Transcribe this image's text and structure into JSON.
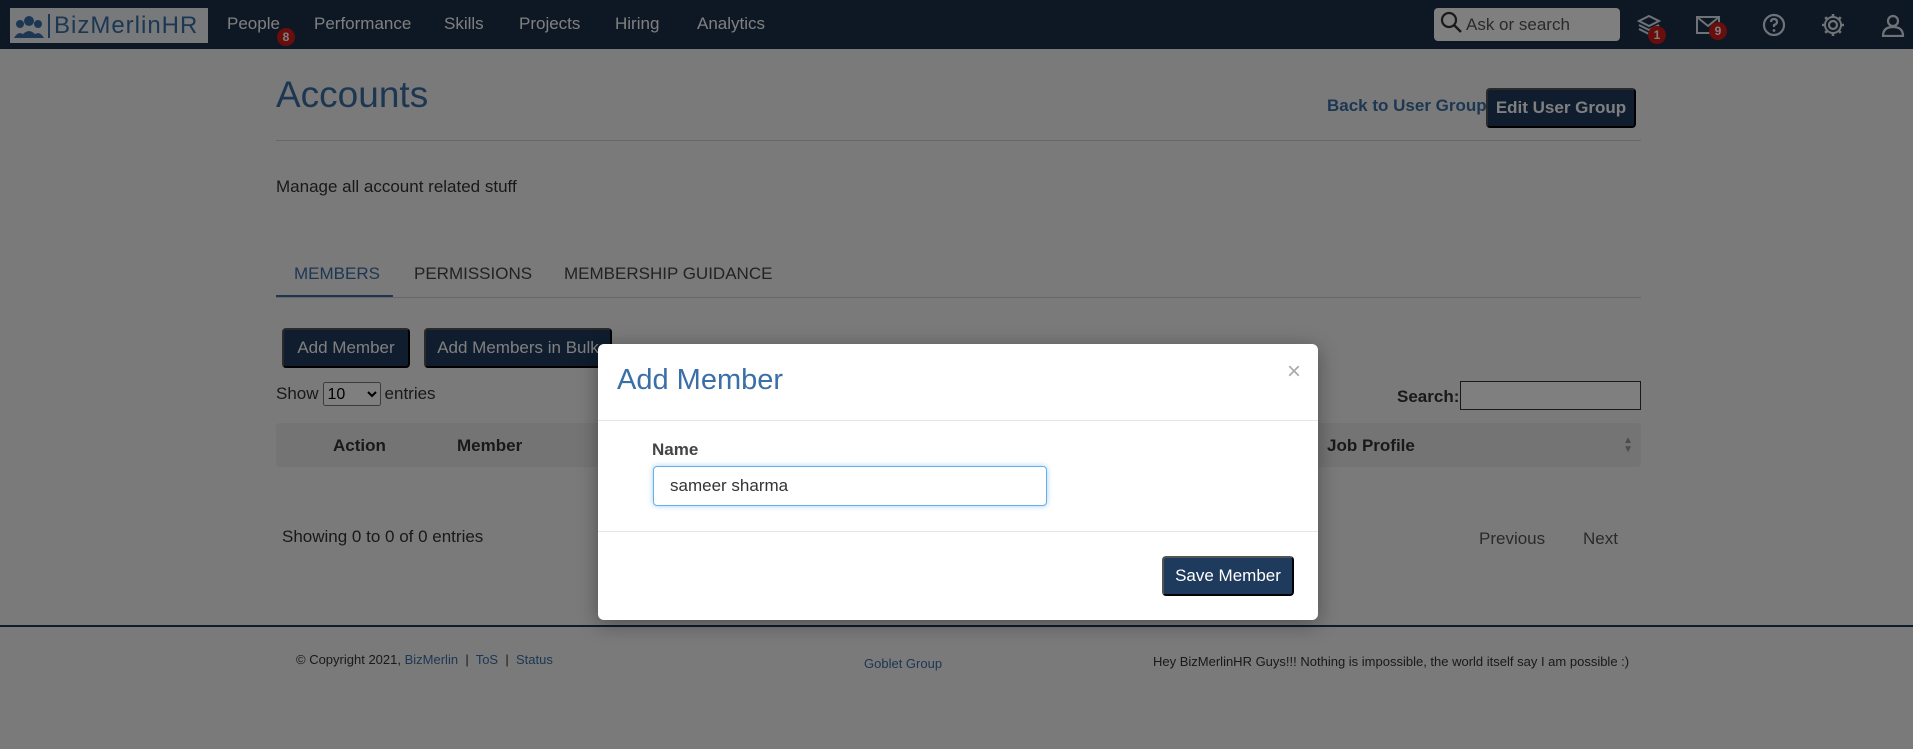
{
  "nav": {
    "logo_text": "BizMerlinHR",
    "items": [
      {
        "label": "People",
        "badge": "8"
      },
      {
        "label": "Performance"
      },
      {
        "label": "Skills"
      },
      {
        "label": "Projects"
      },
      {
        "label": "Hiring"
      },
      {
        "label": "Analytics"
      }
    ],
    "search_placeholder": "Ask or search",
    "icons": [
      {
        "name": "layers-icon",
        "badge": "1"
      },
      {
        "name": "mail-icon",
        "badge": "9"
      },
      {
        "name": "help-icon"
      },
      {
        "name": "gear-icon"
      },
      {
        "name": "user-icon"
      }
    ]
  },
  "page": {
    "title": "Accounts",
    "back_link": "Back to User Groups",
    "edit_button": "Edit User Group",
    "description": "Manage all account related stuff"
  },
  "tabs": [
    {
      "label": "MEMBERS",
      "active": true
    },
    {
      "label": "PERMISSIONS",
      "active": false
    },
    {
      "label": "MEMBERSHIP GUIDANCE",
      "active": false
    }
  ],
  "actions": {
    "add_member": "Add Member",
    "add_bulk": "Add Members in Bulk"
  },
  "table": {
    "show_label": "Show",
    "entries_label": "entries",
    "page_size": "10",
    "search_label": "Search:",
    "columns": [
      "Action",
      "Member",
      "Job Profile"
    ],
    "showing": "Showing 0 to 0 of 0 entries",
    "previous": "Previous",
    "next": "Next"
  },
  "footer": {
    "copyright": "© Copyright 2021,",
    "company_link": "BizMerlin",
    "sep": "|",
    "tos": "ToS",
    "status": "Status",
    "center_link": "Goblet Group",
    "message": "Hey BizMerlinHR Guys!!! Nothing is impossible, the world itself say I am possible :)"
  },
  "modal": {
    "title": "Add Member",
    "close": "×",
    "name_label": "Name",
    "name_value": "sameer sharma",
    "save_button": "Save Member"
  },
  "colors": {
    "nav_bg": "#1b3048",
    "accent": "#3a6fa7",
    "button_dark": "#1e3a5c",
    "badge_red": "#d21b1b"
  }
}
